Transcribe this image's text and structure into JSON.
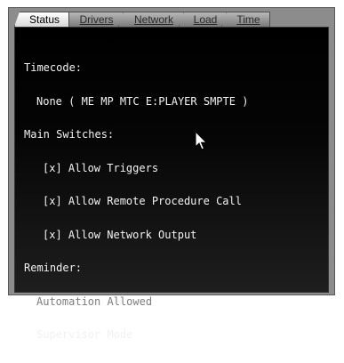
{
  "tabs": [
    {
      "label": "Status",
      "active": true
    },
    {
      "label": "Drivers",
      "active": false
    },
    {
      "label": "Network",
      "active": false
    },
    {
      "label": "Load",
      "active": false
    },
    {
      "label": "Time",
      "active": false
    }
  ],
  "status": {
    "timecode_heading": "Timecode:",
    "timecode_value": "None ( ME MP MTC E:PLAYER SMPTE )",
    "main_switches_heading": "Main Switches:",
    "switches": [
      {
        "text": "[x] Allow Triggers"
      },
      {
        "text": "[x] Allow Remote Procedure Call"
      },
      {
        "text": "[x] Allow Network Output"
      }
    ],
    "reminder_heading": "Reminder:",
    "reminder_items": [
      {
        "text": "Automation Allowed",
        "dimmed": true
      },
      {
        "text": "Supervisor Mode",
        "dimmed": false
      }
    ]
  },
  "icons": {
    "cursor": "mouse-pointer-icon"
  },
  "colors": {
    "panel_bg": "#000000",
    "text": "#f2f2f2",
    "dimmed_text": "#7e7e7e",
    "frame": "#8c8c8c"
  }
}
